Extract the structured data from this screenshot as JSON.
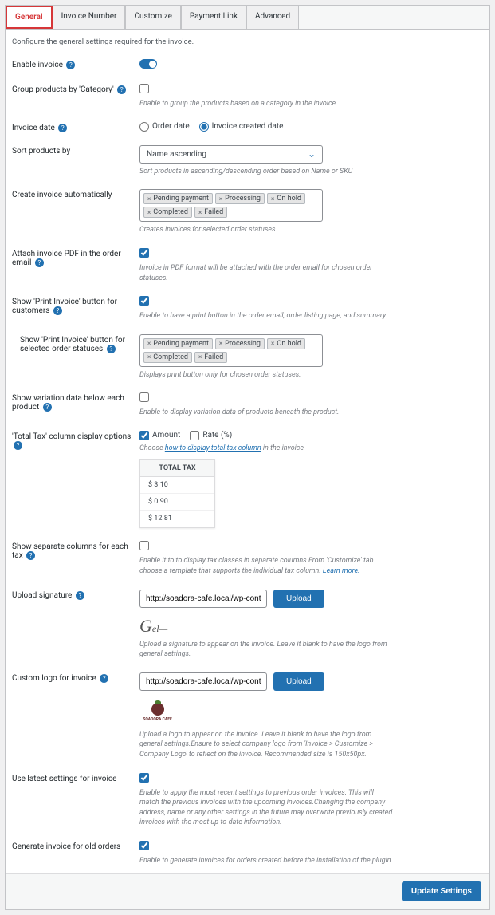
{
  "tabs": [
    "General",
    "Invoice Number",
    "Customize",
    "Payment Link",
    "Advanced"
  ],
  "intro": "Configure the general settings required for the invoice.",
  "enable_invoice": {
    "label": "Enable invoice",
    "value": true
  },
  "group_products": {
    "label": "Group products by 'Category'",
    "value": false,
    "hint": "Enable to group the products based on a category in the invoice."
  },
  "invoice_date": {
    "label": "Invoice date",
    "options": [
      "Order date",
      "Invoice created date"
    ],
    "selected": "Invoice created date"
  },
  "sort_products": {
    "label": "Sort products by",
    "value": "Name ascending",
    "hint": "Sort products in ascending/descending order based on Name or SKU"
  },
  "create_auto": {
    "label": "Create invoice automatically",
    "tags": [
      "Pending payment",
      "Processing",
      "On hold",
      "Completed",
      "Failed"
    ],
    "hint": "Creates invoices for selected order statuses."
  },
  "attach_pdf": {
    "label": "Attach invoice PDF in the order email",
    "value": true,
    "hint": "Invoice in PDF format will be attached with the order email for chosen order statuses."
  },
  "show_print": {
    "label": "Show 'Print Invoice' button for customers",
    "value": true,
    "hint": "Enable to have a print button in the order email, order listing page, and summary."
  },
  "print_statuses": {
    "label": "Show 'Print Invoice' button for selected order statuses",
    "tags": [
      "Pending payment",
      "Processing",
      "On hold",
      "Completed",
      "Failed"
    ],
    "hint": "Displays print button only for chosen order statuses."
  },
  "variation": {
    "label": "Show variation data below each product",
    "value": false,
    "hint": "Enable to display variation data of products beneath the product."
  },
  "total_tax": {
    "label": "'Total Tax' column display options",
    "opts": {
      "amount": "Amount",
      "rate": "Rate (%)"
    },
    "amount_checked": true,
    "rate_checked": false,
    "hint_pre": "Choose ",
    "hint_link": "how to display total tax column",
    "hint_post": " in the invoice",
    "table_header": "TOTAL TAX",
    "rows": [
      "$ 3.10",
      "$ 0.90",
      "$ 12.81"
    ]
  },
  "separate_cols": {
    "label": "Show separate columns for each tax",
    "value": false,
    "hint_pre": "Enable it to to display tax classes in separate columns.From 'Customize' tab choose a template that supports the individual tax column. ",
    "hint_link": "Learn more."
  },
  "upload_sig": {
    "label": "Upload signature",
    "value": "http://soadora-cafe.local/wp-content/up",
    "btn": "Upload",
    "hint": "Upload a signature to appear on the invoice. Leave it blank to have the logo from general settings."
  },
  "custom_logo": {
    "label": "Custom logo for invoice",
    "value": "http://soadora-cafe.local/wp-content/up",
    "btn": "Upload",
    "logo_text": "SOADORA CAFE",
    "hint": "Upload a logo to appear on the invoice. Leave it blank to have the logo from general settings.Ensure to select company logo from 'Invoice > Customize > Company Logo' to reflect on the invoice. Recommended size is 150x50px."
  },
  "latest_settings": {
    "label": "Use latest settings for invoice",
    "value": true,
    "hint": "Enable to apply the most recent settings to previous order invoices. This will match the previous invoices with the upcoming invoices.Changing the company address, name or any other settings in the future may overwrite previously created invoices with the most up-to-date information."
  },
  "old_orders": {
    "label": "Generate invoice for old orders",
    "value": true,
    "hint": "Enable to generate invoices for orders created before the installation of the plugin."
  },
  "update_btn": "Update Settings"
}
